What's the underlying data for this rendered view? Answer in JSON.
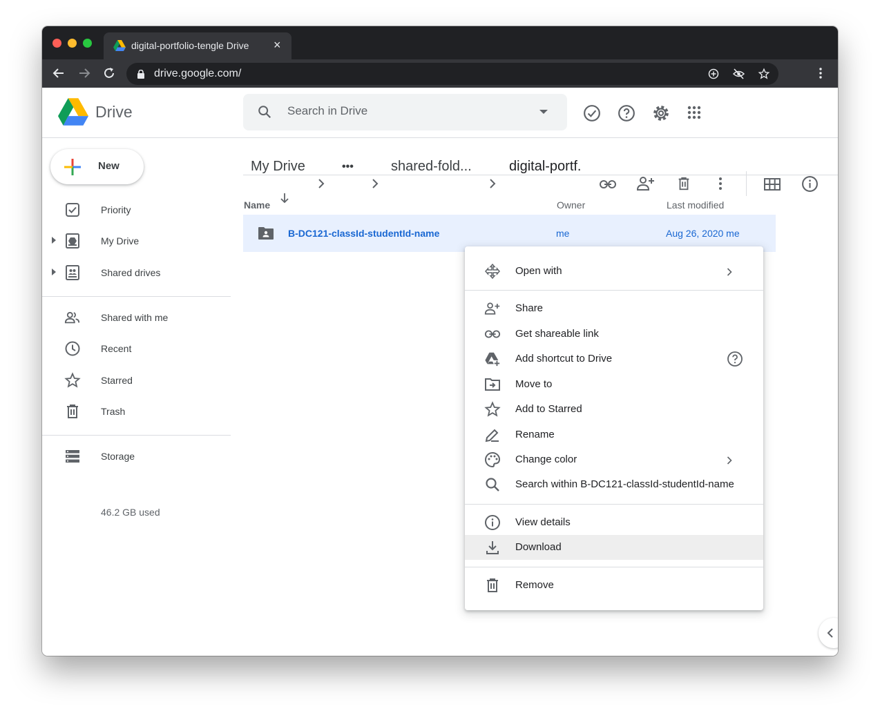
{
  "browser": {
    "tab_title": "digital-portfolio-tengle Drive",
    "url": "drive.google.com/"
  },
  "header": {
    "app_name": "Drive",
    "search_placeholder": "Search in Drive"
  },
  "sidebar": {
    "new_label": "New",
    "items": [
      {
        "label": "Priority",
        "icon": "priority-icon"
      },
      {
        "label": "My Drive",
        "icon": "my-drive-icon"
      },
      {
        "label": "Shared drives",
        "icon": "shared-drives-icon"
      },
      {
        "label": "Shared with me",
        "icon": "shared-with-me-icon"
      },
      {
        "label": "Recent",
        "icon": "recent-icon"
      },
      {
        "label": "Starred",
        "icon": "star-icon"
      },
      {
        "label": "Trash",
        "icon": "trash-icon"
      },
      {
        "label": "Storage",
        "icon": "storage-icon"
      }
    ],
    "storage_used": "46.2 GB used"
  },
  "breadcrumb": {
    "root": "My Drive",
    "ellipsis": "•••",
    "middle": "shared-fold...",
    "current": "digital-portf."
  },
  "file_list": {
    "columns": {
      "name": "Name",
      "owner": "Owner",
      "modified": "Last modified"
    },
    "rows": [
      {
        "name": "B-DC121-classId-studentId-name",
        "owner": "me",
        "modified": "Aug 26, 2020  me"
      }
    ]
  },
  "context_menu": {
    "items": [
      {
        "label": "Open with",
        "icon": "open-with-icon"
      },
      {
        "label": "Share",
        "icon": "share-person-icon"
      },
      {
        "label": "Get shareable link",
        "icon": "link-icon"
      },
      {
        "label": "Add shortcut to Drive",
        "icon": "add-shortcut-icon"
      },
      {
        "label": "Move to",
        "icon": "move-to-icon"
      },
      {
        "label": "Add to Starred",
        "icon": "star-icon"
      },
      {
        "label": "Rename",
        "icon": "rename-icon"
      },
      {
        "label": "Change color",
        "icon": "palette-icon"
      },
      {
        "label": "Search within B-DC121-classId-studentId-name",
        "icon": "search-icon"
      },
      {
        "label": "View details",
        "icon": "info-icon"
      },
      {
        "label": "Download",
        "icon": "download-icon"
      },
      {
        "label": "Remove",
        "icon": "trash-icon"
      }
    ],
    "highlighted": "Download"
  },
  "colors": {
    "accent": "#1967d2",
    "selection": "#e8f0fe",
    "chrome_dark": "#202124"
  }
}
